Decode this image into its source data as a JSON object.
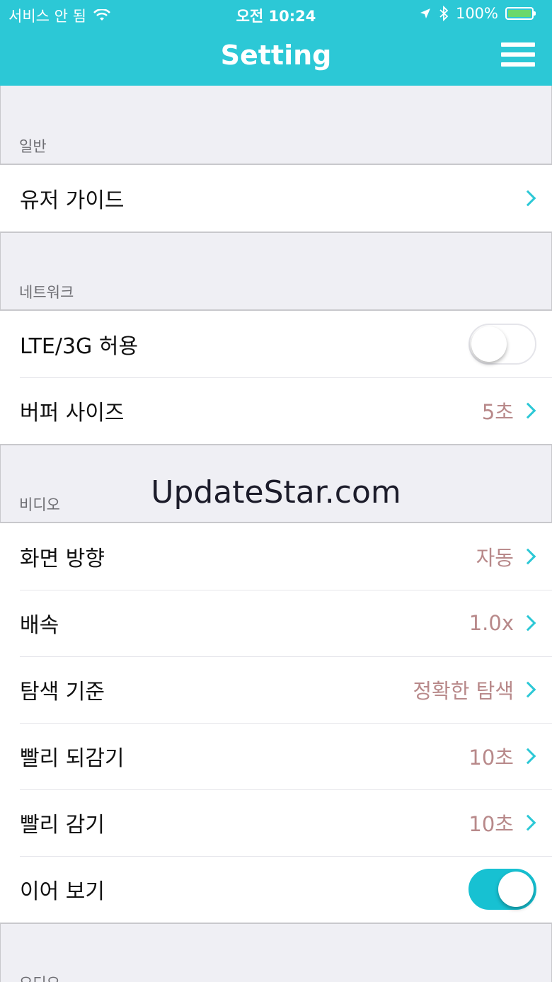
{
  "status_bar": {
    "carrier": "서비스 안 됨",
    "time": "오전 10:24",
    "battery": "100%",
    "battery_level": 1.0
  },
  "nav": {
    "title": "Setting",
    "menu_icon": "hamburger-menu-icon"
  },
  "sections": {
    "general": {
      "header": "일반",
      "user_guide": "유저 가이드"
    },
    "network": {
      "header": "네트워크",
      "lte_label": "LTE/3G 허용",
      "lte_on": false,
      "buffer_label": "버퍼 사이즈",
      "buffer_value": "5초"
    },
    "video": {
      "header": "비디오",
      "orientation_label": "화면 방향",
      "orientation_value": "자동",
      "speed_label": "배속",
      "speed_value": "1.0x",
      "seek_label": "탐색 기준",
      "seek_value": "정확한 탐색",
      "rewind_label": "빨리 되감기",
      "rewind_value": "10초",
      "forward_label": "빨리 감기",
      "forward_value": "10초",
      "resume_label": "이어 보기",
      "resume_on": true
    },
    "audio": {
      "header": "오디오"
    }
  },
  "watermark": "UpdateStar.com",
  "colors": {
    "accent": "#2cc8d6",
    "value_text": "#b8898a",
    "toggle_on": "#17c1d2"
  }
}
